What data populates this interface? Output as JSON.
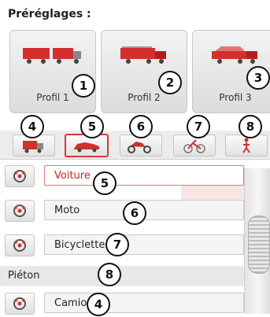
{
  "header": {
    "title": "Préréglages :"
  },
  "profiles": [
    {
      "label": "Profil 1",
      "callout": "1"
    },
    {
      "label": "Profil 2",
      "callout": "2"
    },
    {
      "label": "Profil 3",
      "callout": "3"
    }
  ],
  "vehicle_buttons": [
    {
      "icon": "truck-icon",
      "callout": "4",
      "selected": false
    },
    {
      "icon": "car-icon",
      "callout": "5",
      "selected": true
    },
    {
      "icon": "motorcycle-icon",
      "callout": "6",
      "selected": false
    },
    {
      "icon": "bicycle-icon",
      "callout": "7",
      "selected": false
    },
    {
      "icon": "pedestrian-icon",
      "callout": "8",
      "selected": false
    }
  ],
  "list": [
    {
      "label": "Voiture",
      "callout": "5",
      "selected": true,
      "icon": "settings-wheel-icon"
    },
    {
      "label": "Moto",
      "callout": "6",
      "selected": false,
      "icon": "settings-wheel-icon"
    },
    {
      "label": "Bicyclette",
      "callout": "7",
      "selected": false,
      "icon": "settings-wheel-icon"
    },
    {
      "label": "Piéton",
      "callout": "8",
      "selected": false,
      "icon": ""
    },
    {
      "label": "Camion",
      "callout": "4",
      "selected": false,
      "icon": "settings-wheel-icon"
    }
  ],
  "colors": {
    "accent": "#d23a3a",
    "vehicle_red": "#d32f2f"
  }
}
